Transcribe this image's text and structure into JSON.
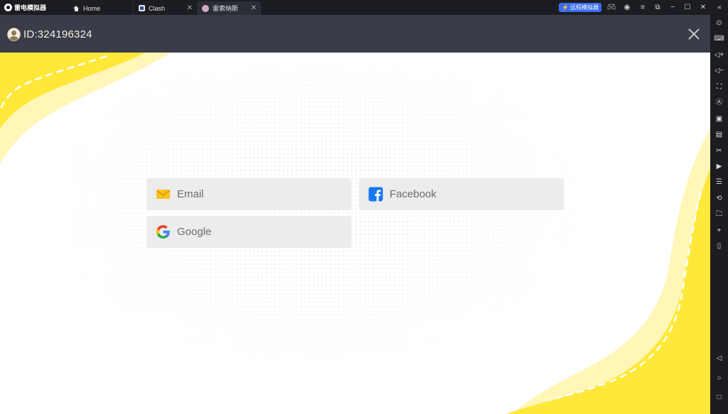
{
  "topbar": {
    "brand": "雷电模拟器",
    "tabs": [
      {
        "label": "Home",
        "icon": "home-icon"
      },
      {
        "label": "Clash",
        "icon": "clash-icon"
      },
      {
        "label": "雷索纳斯",
        "icon": "game-icon"
      }
    ],
    "remote_label": "远程模拟器"
  },
  "header": {
    "user_id": "ID:324196324"
  },
  "login": {
    "email_label": "Email",
    "facebook_label": "Facebook",
    "google_label": "Google"
  },
  "colors": {
    "accent_yellow": "#ffe83a",
    "header_bg": "#3a3d49",
    "facebook_blue": "#1877f2",
    "remote_blue": "#3c6df0"
  }
}
